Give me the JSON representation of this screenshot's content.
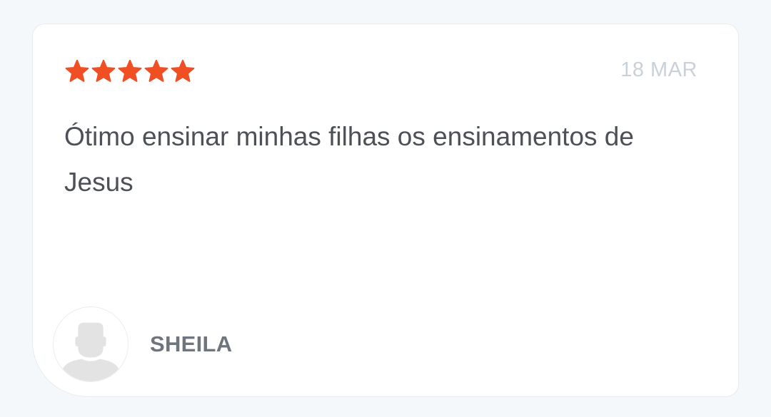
{
  "review": {
    "rating": 5,
    "max_rating": 5,
    "date": "18 MAR",
    "text": "Ótimo ensinar minhas filhas os ensinamentos de Jesus",
    "author": "SHEILA",
    "avatar_icon": "default-user-avatar-icon"
  },
  "colors": {
    "star": "#f04e23",
    "date": "#c9d1d8",
    "text": "#4d5157",
    "author": "#6f757c",
    "background": "#f5f8fb",
    "card": "#ffffff"
  }
}
